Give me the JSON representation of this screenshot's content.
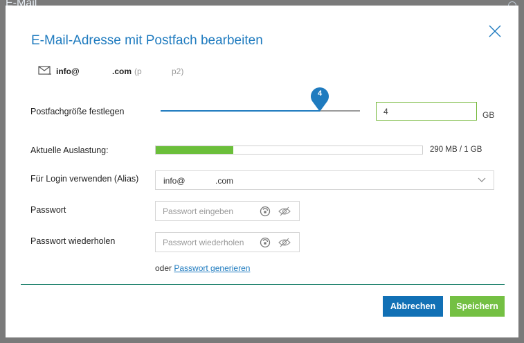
{
  "background": {
    "title": "E-Mail"
  },
  "dialog": {
    "title": "E-Mail-Adresse mit Postfach bearbeiten",
    "email": {
      "local_part": "info@",
      "domain_suffix": ".com",
      "package_prefix": "(p",
      "package_suffix": "p2)"
    },
    "mailbox_size": {
      "label": "Postfachgröße festlegen",
      "slider_value": "4",
      "slider_fraction": 0.8,
      "input_value": "4",
      "unit": "GB"
    },
    "usage": {
      "label": "Aktuelle Auslastung:",
      "fill_fraction": 0.29,
      "text": "290 MB / 1 GB",
      "bar_color": "#6bbf3a"
    },
    "login_alias": {
      "label": "Für Login verwenden (Alias)",
      "selected_prefix": "info@",
      "selected_suffix": ".com"
    },
    "password": {
      "label": "Passwort",
      "placeholder": "Passwort eingeben"
    },
    "password_repeat": {
      "label": "Passwort wiederholen",
      "placeholder": "Passwort wiederholen"
    },
    "generate": {
      "prefix": "oder",
      "link": "Passwort generieren"
    },
    "buttons": {
      "cancel": "Abbrechen",
      "save": "Speichern"
    },
    "colors": {
      "accent": "#1f7bbf",
      "cancel_button": "#1170b5",
      "save_button": "#74c043",
      "input_border_active": "#74b83a"
    }
  }
}
